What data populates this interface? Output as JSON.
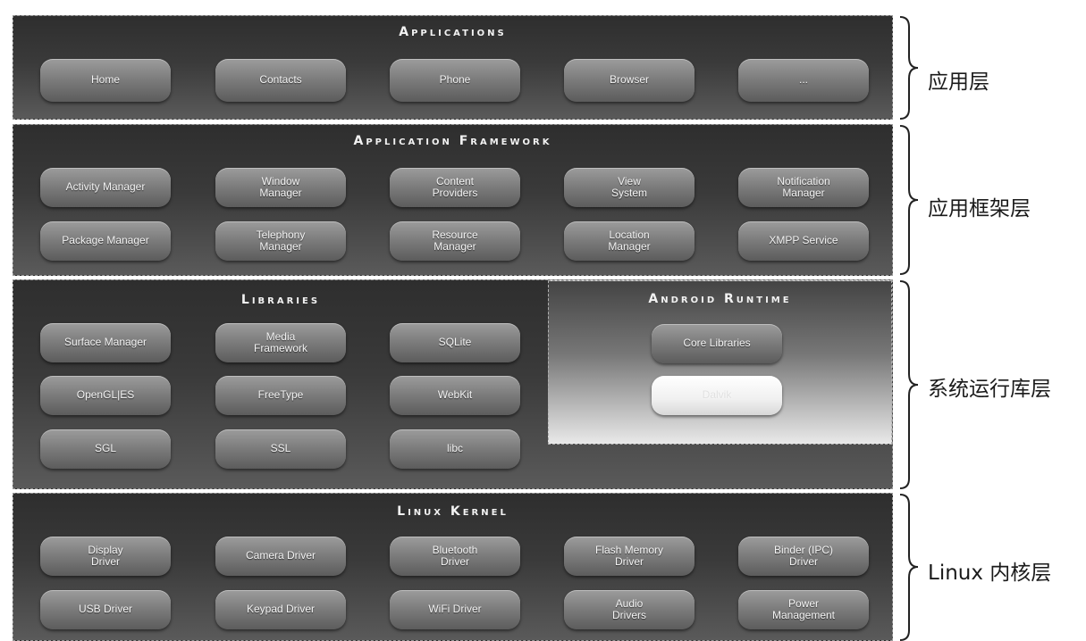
{
  "layers": {
    "applications": {
      "title": "Applications",
      "items": [
        "Home",
        "Contacts",
        "Phone",
        "Browser",
        "..."
      ]
    },
    "framework": {
      "title": "Application Framework",
      "items": [
        "Activity Manager",
        "Window\nManager",
        "Content\nProviders",
        "View\nSystem",
        "Notification\nManager",
        "Package Manager",
        "Telephony\nManager",
        "Resource\nManager",
        "Location\nManager",
        "XMPP Service"
      ]
    },
    "libraries": {
      "title": "Libraries",
      "items": [
        "Surface Manager",
        "Media\nFramework",
        "SQLite",
        "OpenGL|ES",
        "FreeType",
        "WebKit",
        "SGL",
        "SSL",
        "libc"
      ]
    },
    "runtime": {
      "title": "Android Runtime",
      "items": [
        "Core Libraries",
        "Dalvik"
      ]
    },
    "kernel": {
      "title": "Linux Kernel",
      "items": [
        "Display\nDriver",
        "Camera Driver",
        "Bluetooth\nDriver",
        "Flash Memory\nDriver",
        "Binder (IPC)\nDriver",
        "USB Driver",
        "Keypad Driver",
        "WiFi Driver",
        "Audio\nDrivers",
        "Power\nManagement"
      ]
    }
  },
  "side_labels": [
    "应用层",
    "应用框架层",
    "系统运行库层",
    "Linux 内核层"
  ]
}
